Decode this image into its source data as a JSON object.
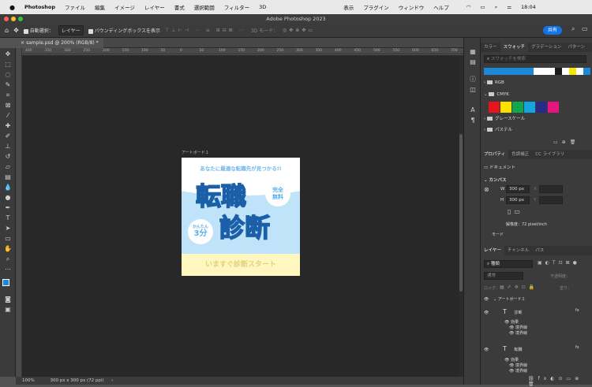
{
  "menubar": {
    "apple": "",
    "app": "Photoshop",
    "items": [
      "ファイル",
      "編集",
      "イメージ",
      "レイヤー",
      "書式",
      "選択範囲",
      "フィルター",
      "3D",
      "表示",
      "プラグイン",
      "ウィンドウ",
      "ヘルプ"
    ],
    "clock": "18:04"
  },
  "window": {
    "title": "Adobe Photoshop 2023"
  },
  "options": {
    "auto_select_label": "自動選択：",
    "auto_select_value": "レイヤー",
    "bbox_label": "バウンディングボックスを表示",
    "mode_3d": "3D モード：",
    "share_label": "共有"
  },
  "document": {
    "tab_label": "sample.psd @ 200% (RGB/8) *"
  },
  "ruler_ticks": [
    "400",
    "350",
    "300",
    "250",
    "200",
    "150",
    "100",
    "50",
    "0",
    "50",
    "100",
    "150",
    "200",
    "250",
    "300",
    "350",
    "400",
    "450",
    "500",
    "550",
    "600",
    "650",
    "700"
  ],
  "artboard": {
    "label": "アートボード１",
    "headline": "あなたに最適な転職先が見つかる!!",
    "big1": "転職",
    "big2": "診断",
    "bubble1": "完全\n無料",
    "bubble2_small": "かんたん",
    "bubble2_big": "3分",
    "footer": "いますぐ診断スタート"
  },
  "status": {
    "zoom": "100%",
    "info": "300 px x 300 px (72 ppi)"
  },
  "swatches_panel": {
    "tabs": [
      "カラー",
      "スウォッチ",
      "グラデーション",
      "パターン"
    ],
    "search_placeholder": "スウォッチを検索",
    "recent": [
      "#1e88d8",
      "#1e88d8",
      "#1e88d8",
      "#1e88d8",
      "#1e88d8",
      "#1e88d8",
      "#1e88d8",
      "#ffffff",
      "#ffffff",
      "#ffffff",
      "#1a1a1a",
      "#ffffff",
      "#f5e50a",
      "#ffffff",
      "#1e88d8"
    ],
    "groups": [
      "RGB",
      "CMYK",
      "グレースケール",
      "パステル"
    ],
    "cmyk_colors": [
      "#e8141b",
      "#f8e300",
      "#12a64a",
      "#14a4e0",
      "#29298a",
      "#e4157e"
    ]
  },
  "properties_panel": {
    "tabs": [
      "プロパティ",
      "色調補正",
      "CC ライブラリ"
    ],
    "doc_label": "ドキュメント",
    "canvas_label": "カンバス",
    "w_label": "W",
    "w_value": "300 px",
    "h_label": "H",
    "h_value": "300 px",
    "x_label": "X",
    "y_label": "Y",
    "resolution": "解像度：72 pixel/inch",
    "mode_label": "モード"
  },
  "layers_panel": {
    "tabs": [
      "レイヤー",
      "チャンネル",
      "パス"
    ],
    "kind_value": "種類",
    "normal_value": "通常",
    "opacity_label": "不透明度：",
    "lock_label": "ロック：",
    "fill_label": "塗り：",
    "artboard_layer": "アートボード１",
    "layer1": "診断",
    "layer2": "転職",
    "effect_label": "効果",
    "stroke_label": "境界線",
    "fx": "fx"
  }
}
